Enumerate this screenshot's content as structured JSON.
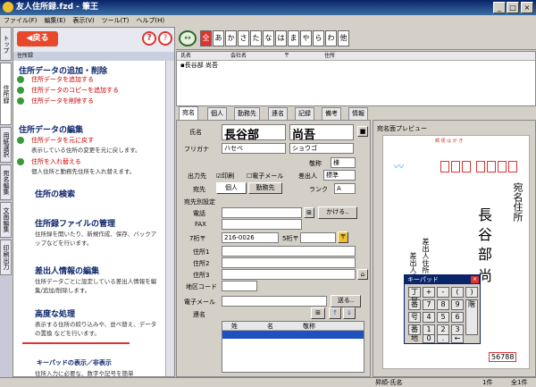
{
  "window": {
    "title": "友人住所録.fzd - 筆王"
  },
  "menubar": {
    "items": [
      "ファイル(F)",
      "編集(E)",
      "表示(V)",
      "ツール(T)",
      "ヘルプ(H)"
    ]
  },
  "vtabs": [
    "トップ",
    "住所録",
    "用紙選択",
    "宛名編集",
    "文面編集",
    "印刷出力"
  ],
  "left": {
    "back": "戻る",
    "header": "住所録",
    "sections": [
      {
        "title": "住所データの追加・削除",
        "items": [
          "住所データを追加する",
          "住所データのコピーを追加する",
          "住所データを削除する"
        ]
      },
      {
        "title": "住所データの編集",
        "items": [
          "住所データを元に戻す",
          "住所を入れ替える"
        ],
        "descs": [
          "表示している住所の変更を元に戻します。",
          "個人住所と勤務先住所を入れ替えます。"
        ]
      },
      {
        "title": "住所の検索"
      },
      {
        "title": "住所録ファイルの管理",
        "desc": "住所録を開いたり、新規作成、保存、バックアップなどを行います。"
      },
      {
        "title": "差出人情報の編集",
        "desc": "住所データごとに設定している差出人情報を編集/追加/削除します。"
      },
      {
        "title": "高度な処理",
        "desc": "表示する住所の絞り込みや、並べ替え、データの置換 などを行います。"
      },
      {
        "title": "キーパッドの表示／非表示",
        "desc": "住所入力に必要な、数字や記号を簡単"
      }
    ]
  },
  "kana": [
    "全",
    "あ",
    "か",
    "さ",
    "た",
    "な",
    "は",
    "ま",
    "や",
    "ら",
    "わ",
    "他"
  ],
  "list": {
    "headers": [
      "氏名",
      "会社名",
      "〒",
      "住所"
    ],
    "rows": [
      [
        "長谷部 尚吾"
      ]
    ]
  },
  "tabs": [
    "宛名",
    "個人",
    "勤務先",
    "連名",
    "記録",
    "備考",
    "情報"
  ],
  "form": {
    "name_label": "氏名",
    "last": "長谷部",
    "first": "尚吾",
    "furi_label": "フリガナ",
    "furi_last": "ハセベ",
    "furi_first": "ショウゴ",
    "title_label": "敬称",
    "title_val": "様",
    "output_label": "出力先",
    "print_label": "印刷",
    "email_label": "電子メール",
    "sender_label": "差出人",
    "sender_val": "標準",
    "dest_label": "宛先",
    "dest_personal": "個人",
    "dest_work": "勤務先",
    "rank_label": "ランク",
    "rank_val": "A",
    "addr_setting": "宛先別設定",
    "tel_label": "電話",
    "call_btn": "かける..",
    "fax_label": "FAX",
    "zip7_label": "7桁〒",
    "zip7_val": "216-0026",
    "zip5_label": "5桁〒",
    "addr1": "住所1",
    "addr2": "住所2",
    "addr3": "住所3",
    "area": "地区コード",
    "mail_label": "電子メール",
    "send_btn": "送る..",
    "joint_label": "連名",
    "joint_headers": [
      "姓",
      "名",
      "敬称"
    ]
  },
  "preview": {
    "label": "宛名面プレビュー",
    "postage": "郵 便 は が き",
    "recipient": [
      "宛名住所",
      "長谷部",
      "尚"
    ],
    "sender": [
      "差出人住所",
      "差出人氏名"
    ],
    "zip": "56788"
  },
  "keypad": {
    "title": "キーパッド",
    "keys": [
      "丁目",
      "+",
      "-",
      "(",
      ")",
      "番",
      "7",
      "8",
      "9",
      "号",
      "4",
      "5",
      "6",
      "番地",
      "1",
      "2",
      "3",
      "階",
      "0",
      ".",
      "←"
    ]
  },
  "status": {
    "sort": "昇順-氏名",
    "count": "1件",
    "total": "全1件"
  }
}
